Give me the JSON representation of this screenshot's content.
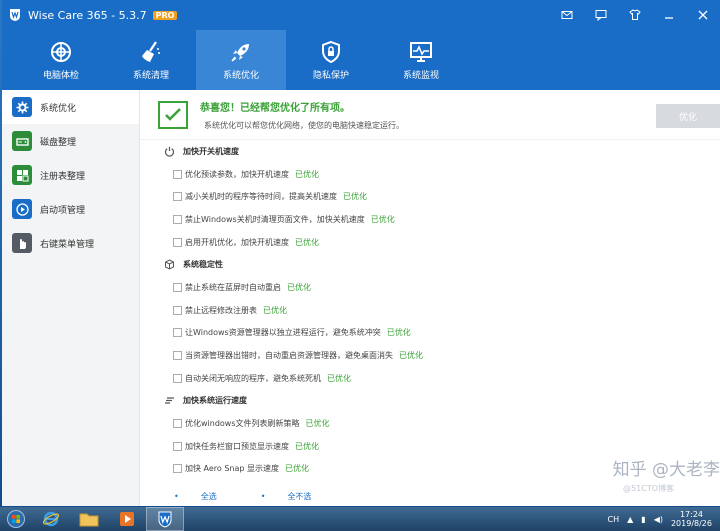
{
  "app": {
    "title": "Wise Care 365 - 5.3.7",
    "badge": "PRO"
  },
  "nav": {
    "items": [
      {
        "label": "电脑体检",
        "icon": "radar-icon"
      },
      {
        "label": "系统清理",
        "icon": "broom-icon"
      },
      {
        "label": "系统优化",
        "icon": "rocket-icon",
        "active": true
      },
      {
        "label": "隐私保护",
        "icon": "lock-shield-icon"
      },
      {
        "label": "系统监视",
        "icon": "monitor-pulse-icon"
      }
    ]
  },
  "sidebar": {
    "items": [
      {
        "label": "系统优化",
        "icon": "gear-icon",
        "color": "#1a6dc6",
        "active": true
      },
      {
        "label": "磁盘整理",
        "icon": "disk-icon",
        "color": "#2d8c3a"
      },
      {
        "label": "注册表整理",
        "icon": "grid-icon",
        "color": "#2d8c3a"
      },
      {
        "label": "启动项管理",
        "icon": "play-icon",
        "color": "#1a6dc6"
      },
      {
        "label": "右键菜单管理",
        "icon": "hand-icon",
        "color": "#555b63"
      }
    ]
  },
  "banner": {
    "title": "恭喜您！已经帮您优化了所有项。",
    "subtitle": "系统优化可以帮您优化网络，使您的电脑快速稳定运行。",
    "button": "优化"
  },
  "sections": [
    {
      "title": "加快开关机速度",
      "icon": "power-icon",
      "items": [
        {
          "label": "优化预读参数，加快开机速度",
          "status": "已优化"
        },
        {
          "label": "减小关机时的程序等待时间，提高关机速度",
          "status": "已优化"
        },
        {
          "label": "禁止Windows关机时清理页面文件，加快关机速度",
          "status": "已优化"
        },
        {
          "label": "启用开机优化，加快开机速度",
          "status": "已优化"
        }
      ]
    },
    {
      "title": "系统稳定性",
      "icon": "cube-icon",
      "items": [
        {
          "label": "禁止系统在蓝屏时自动重启",
          "status": "已优化"
        },
        {
          "label": "禁止远程修改注册表",
          "status": "已优化"
        },
        {
          "label": "让Windows资源管理器以独立进程运行，避免系统冲突",
          "status": "已优化"
        },
        {
          "label": "当资源管理器出错时，自动重启资源管理器，避免桌面消失",
          "status": "已优化"
        },
        {
          "label": "自动关闭无响应的程序，避免系统死机",
          "status": "已优化"
        }
      ]
    },
    {
      "title": "加快系统运行速度",
      "icon": "speed-icon",
      "items": [
        {
          "label": "优化windows文件列表刷新策略",
          "status": "已优化"
        },
        {
          "label": "加快任务栏窗口预览显示速度",
          "status": "已优化"
        },
        {
          "label": "加快 Aero Snap 显示速度",
          "status": "已优化"
        }
      ]
    }
  ],
  "footer": {
    "select_all": "全选",
    "select_none": "全不选"
  },
  "watermark": {
    "main": "知乎 @大老李",
    "sub": "@51CTO博客"
  },
  "taskbar": {
    "lang": "CH",
    "time": "17:24",
    "date": "2019/8/26"
  }
}
